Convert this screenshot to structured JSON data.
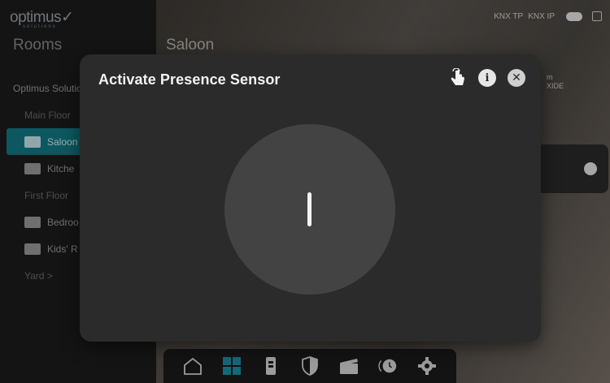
{
  "header": {
    "logo_text": "optimus",
    "logo_tagline": "solutions",
    "connections": [
      "KNX TP",
      "KNX IP"
    ]
  },
  "sidebar": {
    "title": "Rooms",
    "items": [
      {
        "label": "Optimus Solutio",
        "kind": "group"
      },
      {
        "label": "Main Floor",
        "kind": "section"
      },
      {
        "label": "Saloon",
        "kind": "room",
        "active": true
      },
      {
        "label": "Kitche",
        "kind": "room"
      },
      {
        "label": "First Floor",
        "kind": "section"
      },
      {
        "label": "Bedroo",
        "kind": "room"
      },
      {
        "label": "Kids' R",
        "kind": "room"
      },
      {
        "label": "Yard  >",
        "kind": "section"
      }
    ]
  },
  "main": {
    "title": "Saloon",
    "side_text_1": "m",
    "side_text_2": "XIDE"
  },
  "modal": {
    "title": "Activate Presence Sensor",
    "actions": [
      "touch-icon",
      "info-icon",
      "close-icon"
    ],
    "toggle_state": "off"
  },
  "dock": {
    "items": [
      "home-icon",
      "rooms-grid-icon",
      "device-icon",
      "security-icon",
      "scenes-icon",
      "timers-icon",
      "settings-icon"
    ],
    "active": "rooms-grid-icon"
  },
  "colors": {
    "accent": "#127a86",
    "modal_bg": "#2b2b2b",
    "disc": "#434343"
  }
}
